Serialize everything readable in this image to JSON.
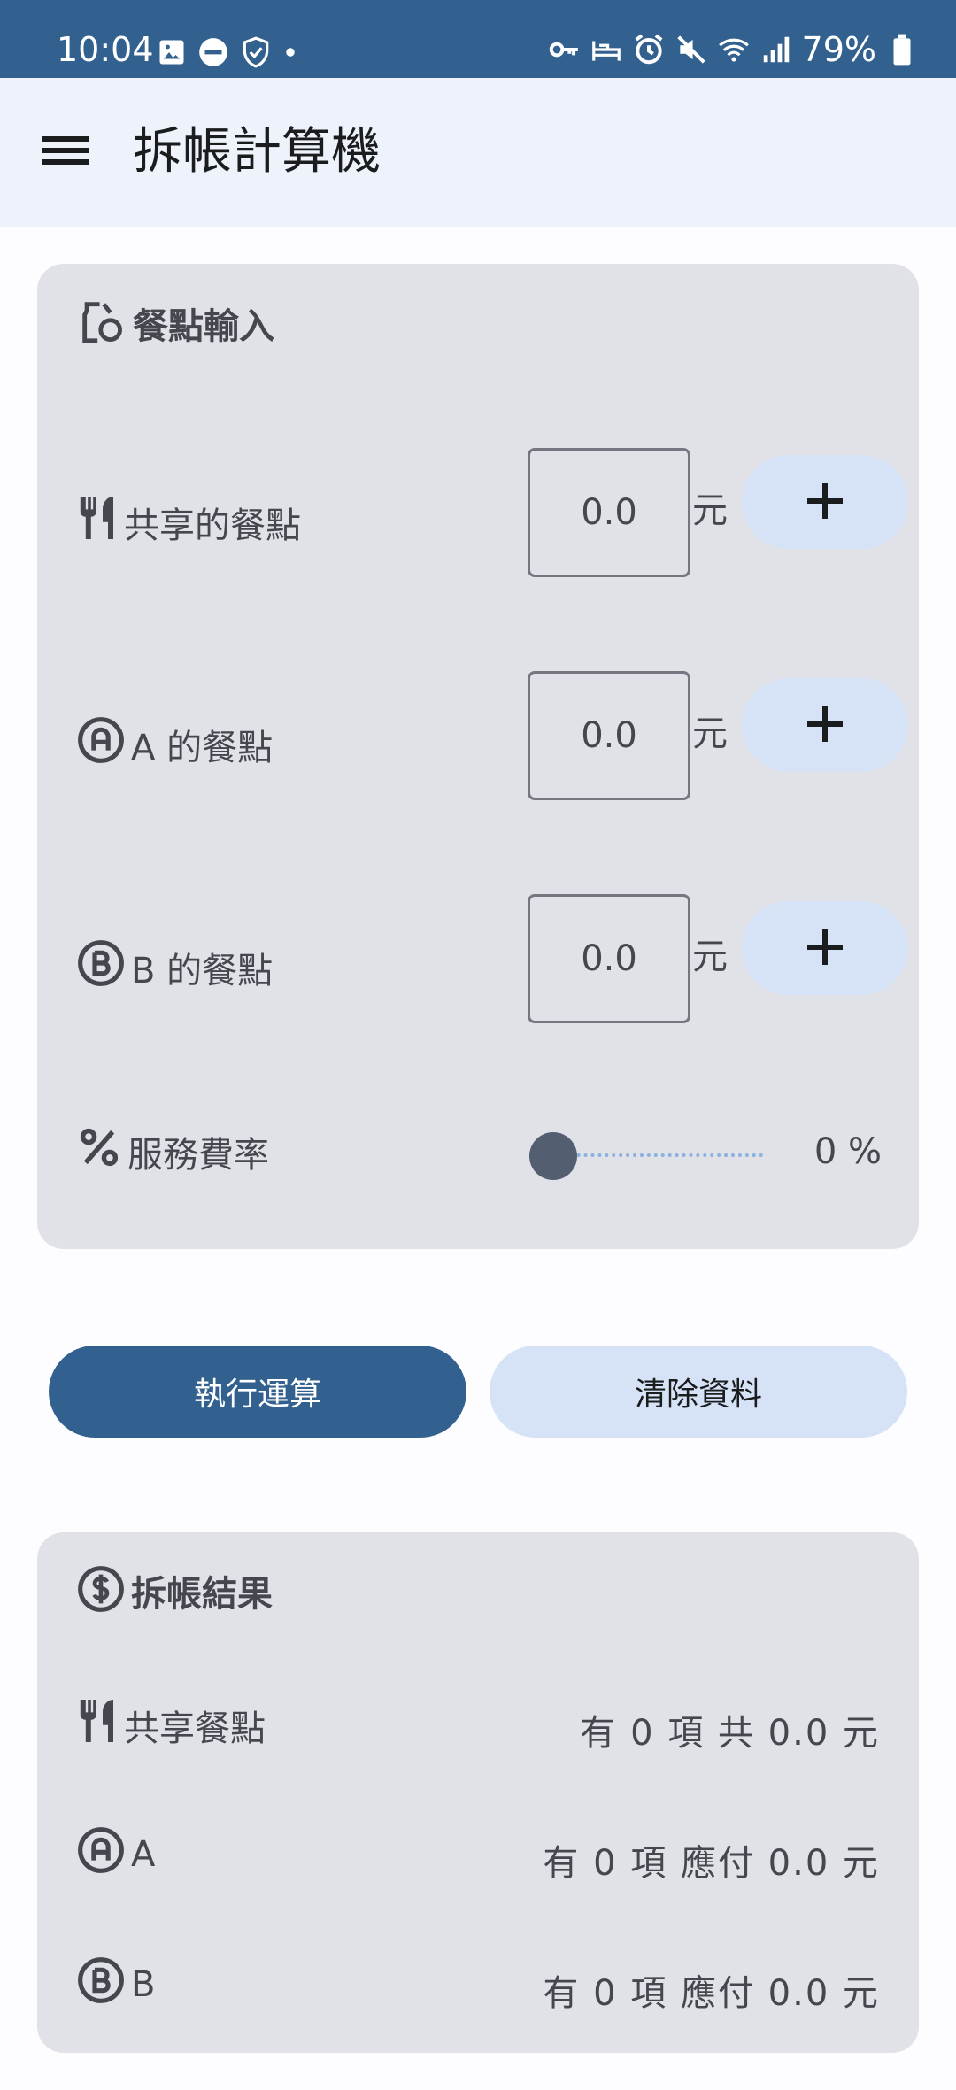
{
  "status_bar": {
    "time": "10:04",
    "battery": "79%",
    "left_icons": [
      "image-icon",
      "do-not-disturb-icon",
      "shield-icon",
      "dot-icon"
    ],
    "right_icons": [
      "vpn-key-icon",
      "bed-icon",
      "alarm-icon",
      "mute-icon",
      "wifi-icon",
      "signal-icon",
      "battery-icon"
    ]
  },
  "app_bar": {
    "title": "拆帳計算機",
    "menu_icon": "menu-icon"
  },
  "input_card": {
    "title": "餐點輸入",
    "title_icon": "food-bank-icon",
    "rows": [
      {
        "label": "共享的餐點",
        "icon": "restaurant-icon",
        "value": "0.0",
        "unit": "元",
        "add_icon": "plus-icon"
      },
      {
        "label": "A 的餐點",
        "icon": "circled-a-icon",
        "value": "0.0",
        "unit": "元",
        "add_icon": "plus-icon"
      },
      {
        "label": "B 的餐點",
        "icon": "circled-b-icon",
        "value": "0.0",
        "unit": "元",
        "add_icon": "plus-icon"
      }
    ],
    "service_rate": {
      "label": "服務費率",
      "icon": "percent-icon",
      "value_text": "0 %",
      "slider_level": 0
    }
  },
  "actions": {
    "calculate": "執行運算",
    "clear": "清除資料"
  },
  "result_card": {
    "title": "拆帳結果",
    "title_icon": "dollar-circle-icon",
    "rows": [
      {
        "label": "共享餐點",
        "icon": "restaurant-icon",
        "value": "有 0 項 共 0.0 元"
      },
      {
        "label": "A",
        "icon": "circled-a-icon",
        "value": "有 0 項 應付 0.0 元"
      },
      {
        "label": "B",
        "icon": "circled-b-icon",
        "value": "有 0 項 應付 0.0 元"
      }
    ]
  },
  "colors": {
    "primary": "#33618f",
    "app_bar_bg": "#eef2fb",
    "card_bg": "#e0e2e8",
    "tonal_button": "#d6e3f7",
    "text": "#44474e"
  }
}
